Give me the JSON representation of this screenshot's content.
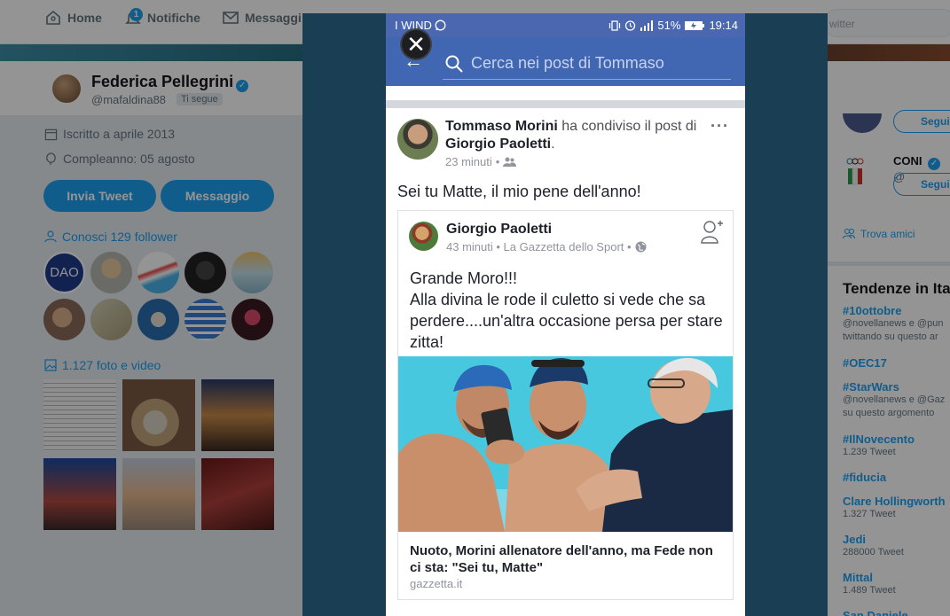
{
  "twitter": {
    "nav": {
      "home": "Home",
      "notifications": "Notifiche",
      "notifications_badge": "1",
      "messages": "Messaggi",
      "search_placeholder": "witter"
    },
    "profile": {
      "name": "Federica Pellegrini",
      "handle": "@mafaldina88",
      "follows_you": "Ti segue",
      "joined": "Iscritto a aprile 2013",
      "birthday": "Compleanno: 05 agosto",
      "tweet_button": "Invia Tweet",
      "message_button": "Messaggio",
      "followers_you_know": "Conosci 129 follower",
      "follower_avatar_1_text": "DAO",
      "media_label": "1.127 foto e video"
    },
    "sidebar": {
      "follow_label": "Segui",
      "follow_label_2": "Segui",
      "coni_name": "CONI",
      "coni_handle": "@",
      "find_friends": "Trova amici",
      "trends_title": "Tendenze in Ita",
      "trends": [
        {
          "tag": "#10ottobre",
          "sub": "@novellanews e @pun"
        },
        {
          "tag": "",
          "sub": "twittando su questo ar"
        },
        {
          "tag": "#OEC17",
          "sub": ""
        },
        {
          "tag": "#StarWars",
          "sub": "@novellanews e @Gaz"
        },
        {
          "tag": "",
          "sub": "su questo argomento"
        },
        {
          "tag": "#IlNovecento",
          "sub": "1.239 Tweet"
        },
        {
          "tag": "#fiducia",
          "sub": ""
        },
        {
          "tag": "Clare Hollingworth",
          "sub": "1.327 Tweet"
        },
        {
          "tag": "Jedi",
          "sub": "288000 Tweet"
        },
        {
          "tag": "Mittal",
          "sub": "1.489 Tweet"
        },
        {
          "tag": "San Daniele",
          "sub": ""
        }
      ]
    }
  },
  "phone": {
    "status": {
      "carrier": "I WIND",
      "battery": "51%",
      "time": "19:14"
    },
    "fb_search_placeholder": "Cerca nei post di Tommaso",
    "post": {
      "author": "Tommaso Morini",
      "action_text": " ha condiviso il post di ",
      "shared_from": "Giorgio Paoletti",
      "period": ".",
      "time": "23 minuti",
      "text": "Sei tu Matte, il mio pene dell'anno!",
      "more": "···",
      "shared": {
        "author": "Giorgio Paoletti",
        "meta": "43 minuti • La Gazzetta dello Sport •",
        "lines": [
          "Grande Moro!!!",
          "Alla divina le rode il culetto si vede che sa",
          "perdere....un'altra occasione persa per stare",
          "zitta!"
        ],
        "link_title": "Nuoto, Morini allenatore dell'anno, ma Fede non ci sta: \"Sei tu, Matte\"",
        "link_domain": "gazzetta.it"
      }
    }
  },
  "colors": {
    "twitter_blue": "#1da1f2",
    "facebook_blue": "#4267b2",
    "lightbox_bg": "#1a3f55"
  }
}
